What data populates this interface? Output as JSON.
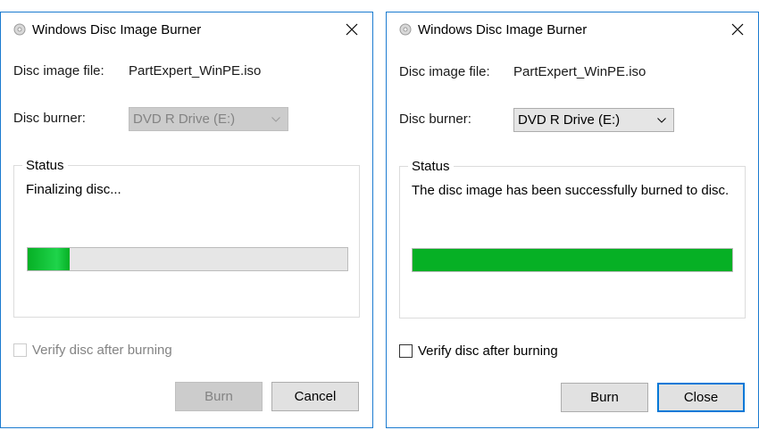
{
  "dialogs": [
    {
      "title": "Windows Disc Image Burner",
      "disc_image_label": "Disc image file:",
      "disc_image_value": "PartExpert_WinPE.iso",
      "burner_label": "Disc burner:",
      "burner_value": "DVD R Drive (E:)",
      "status_legend": "Status",
      "status_message": "Finalizing disc...",
      "progress": 0.13,
      "verify_label": "Verify disc after burning",
      "burn_label": "Burn",
      "second_button_label": "Cancel"
    },
    {
      "title": "Windows Disc Image Burner",
      "disc_image_label": "Disc image file:",
      "disc_image_value": "PartExpert_WinPE.iso",
      "burner_label": "Disc burner:",
      "burner_value": "DVD R Drive (E:)",
      "status_legend": "Status",
      "status_message": "The disc image has been successfully burned to disc.",
      "progress": 1.0,
      "verify_label": "Verify disc after burning",
      "burn_label": "Burn",
      "second_button_label": "Close"
    }
  ],
  "icons": {
    "app": "disc-burner-icon",
    "close": "close-icon",
    "dropdown": "chevron-down-icon"
  },
  "colors": {
    "accent": "#0078d7",
    "progress_fill": "#06b025"
  }
}
